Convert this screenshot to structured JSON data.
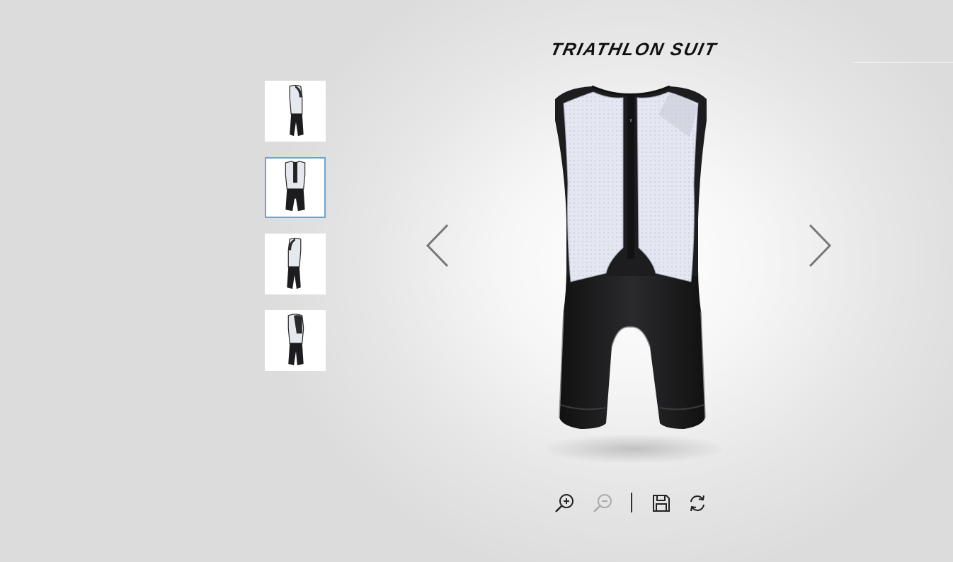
{
  "product": {
    "title": "TRIATHLON SUIT"
  },
  "thumbnails": [
    {
      "view": "left-side",
      "selected": false
    },
    {
      "view": "front",
      "selected": true
    },
    {
      "view": "right-side",
      "selected": false
    },
    {
      "view": "back-side",
      "selected": false
    }
  ],
  "navigation": {
    "prev_icon": "chevron-left-icon",
    "next_icon": "chevron-right-icon"
  },
  "toolbar": {
    "zoom_in_icon": "zoom-in-icon",
    "zoom_out_icon": "zoom-out-icon",
    "zoom_out_enabled": false,
    "save_icon": "save-icon",
    "rotate_icon": "refresh-icon"
  },
  "colors": {
    "selected_border": "#6ba3d6",
    "suit_black": "#1b1b1d",
    "suit_mesh": "#e4e6f0"
  }
}
